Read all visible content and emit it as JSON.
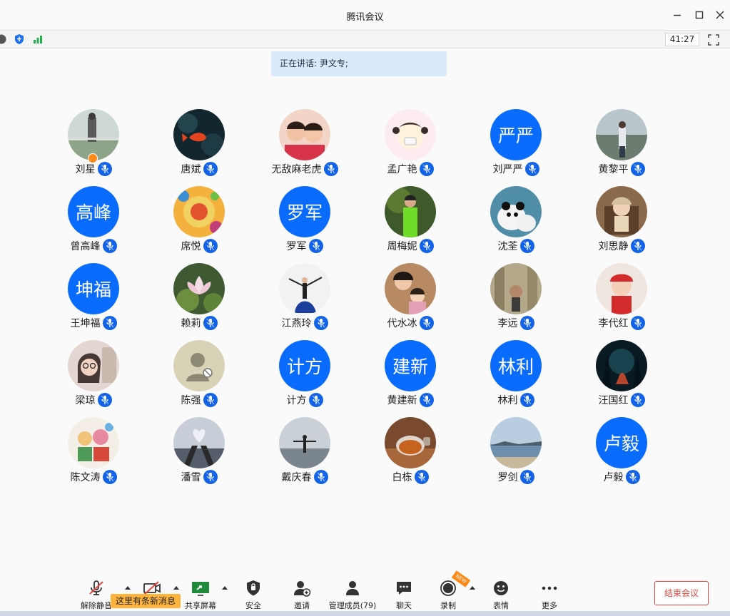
{
  "window": {
    "title": "腾讯会议"
  },
  "toolbar": {
    "timer": "41:27"
  },
  "speaking": {
    "text": "正在讲话: 尹文专;"
  },
  "participants": [
    {
      "name": "刘星",
      "initials": "",
      "photo": "man-by-lake"
    },
    {
      "name": "唐斌",
      "initials": "",
      "photo": "koi-fish"
    },
    {
      "name": "无敌麻老虎",
      "initials": "",
      "photo": "twin-girls"
    },
    {
      "name": "孟广艳",
      "initials": "",
      "photo": "cartoon-girl"
    },
    {
      "name": "刘严严",
      "initials": "严严",
      "photo": ""
    },
    {
      "name": "黄黎平",
      "initials": "",
      "photo": "man-standing"
    },
    {
      "name": "曾高峰",
      "initials": "高峰",
      "photo": ""
    },
    {
      "name": "席悦",
      "initials": "",
      "photo": "colorful-art"
    },
    {
      "name": "罗军",
      "initials": "罗军",
      "photo": ""
    },
    {
      "name": "周梅妮",
      "initials": "",
      "photo": "woman-green"
    },
    {
      "name": "沈荃",
      "initials": "",
      "photo": "pandas"
    },
    {
      "name": "刘思静",
      "initials": "",
      "photo": "baby-chair"
    },
    {
      "name": "王坤福",
      "initials": "坤福",
      "photo": ""
    },
    {
      "name": "赖莉",
      "initials": "",
      "photo": "lotus"
    },
    {
      "name": "江燕玲",
      "initials": "",
      "photo": "dancer"
    },
    {
      "name": "代水冰",
      "initials": "",
      "photo": "mother-child"
    },
    {
      "name": "李远",
      "initials": "",
      "photo": "man-rocks"
    },
    {
      "name": "李代红",
      "initials": "",
      "photo": "baby-red"
    },
    {
      "name": "梁琼",
      "initials": "",
      "photo": "woman-glasses"
    },
    {
      "name": "陈强",
      "initials": "",
      "photo": "default-avatar"
    },
    {
      "name": "计方",
      "initials": "计方",
      "photo": ""
    },
    {
      "name": "黄建新",
      "initials": "建新",
      "photo": ""
    },
    {
      "name": "林利",
      "initials": "林利",
      "photo": ""
    },
    {
      "name": "汪国红",
      "initials": "",
      "photo": "dark-forest"
    },
    {
      "name": "陈文涛",
      "initials": "",
      "photo": "cartoon-drawing"
    },
    {
      "name": "潘雪",
      "initials": "",
      "photo": "heart-hands"
    },
    {
      "name": "戴庆春",
      "initials": "",
      "photo": "silhouette-sea"
    },
    {
      "name": "白栋",
      "initials": "",
      "photo": "tea-cup"
    },
    {
      "name": "罗剑",
      "initials": "",
      "photo": "seascape"
    },
    {
      "name": "卢毅",
      "initials": "卢毅",
      "photo": ""
    }
  ],
  "bottombar": {
    "unmute": "解除静音",
    "share": "共享屏幕",
    "security": "安全",
    "invite": "邀请",
    "members": "管理成员(79)",
    "chat": "聊天",
    "record": "录制",
    "reactions": "表情",
    "more": "更多",
    "new_badge": "NEW",
    "toast": "这里有条新消息",
    "end": "结束会议"
  },
  "colors": {
    "accent": "#0a6cff",
    "end": "#e0463e",
    "toast": "#ffb43d"
  }
}
